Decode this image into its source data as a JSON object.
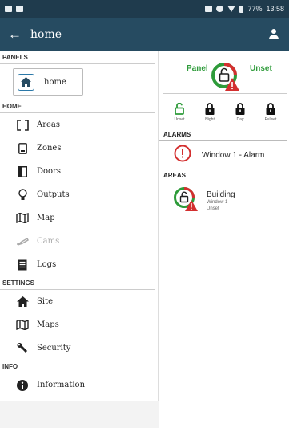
{
  "status_bar": {
    "battery": "77%",
    "time": "13:58"
  },
  "app_bar": {
    "back_icon": "arrow-left-icon",
    "title": "home",
    "user_icon": "user-icon"
  },
  "sidebar": {
    "panels_header": "PANELS",
    "panel": {
      "label": "home",
      "icon": "home-icon"
    },
    "home_header": "HOME",
    "home_items": [
      {
        "label": "Areas",
        "icon": "square-bracket-icon"
      },
      {
        "label": "Zones",
        "icon": "device-icon"
      },
      {
        "label": "Doors",
        "icon": "door-icon"
      },
      {
        "label": "Outputs",
        "icon": "bulb-icon"
      },
      {
        "label": "Map",
        "icon": "map-icon"
      },
      {
        "label": "Cams",
        "icon": "camera-icon",
        "disabled": true
      },
      {
        "label": "Logs",
        "icon": "list-icon"
      }
    ],
    "settings_header": "SETTINGS",
    "settings_items": [
      {
        "label": "Site",
        "icon": "house-icon"
      },
      {
        "label": "Maps",
        "icon": "map-icon"
      },
      {
        "label": "Security",
        "icon": "wrench-icon"
      }
    ],
    "info_header": "INFO",
    "info_items": [
      {
        "label": "Information",
        "icon": "info-icon"
      }
    ]
  },
  "main": {
    "panel_label": "Panel",
    "panel_state": "Unset",
    "modes": [
      {
        "label": "Unset",
        "active": true
      },
      {
        "label": "Night"
      },
      {
        "label": "Day"
      },
      {
        "label": "Fullset"
      }
    ],
    "alarms_header": "ALARMS",
    "alarm": {
      "text": "Window 1 - Alarm"
    },
    "areas_header": "AREAS",
    "area": {
      "name": "Building",
      "line1": "Window 1",
      "line2": "Unset"
    }
  },
  "colors": {
    "appbar": "#264b61",
    "statusbar": "#1f3b4d",
    "green": "#2e9b3a",
    "red": "#d32f2f",
    "accent": "#2a78a8"
  }
}
